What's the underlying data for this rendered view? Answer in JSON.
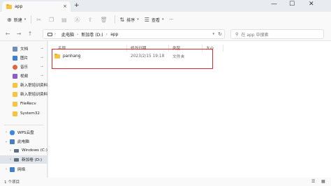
{
  "window": {
    "tab_title": "app",
    "tab_close": "×",
    "new_tab": "+",
    "minimize": "—",
    "maximize": "☐",
    "close": "✕"
  },
  "toolbar": {
    "new_label": "新建",
    "sort_label": "排序",
    "view_label": "查看",
    "more_label": "···"
  },
  "address": {
    "crumbs": [
      "此电脑",
      "新加卷 (D:)",
      "app"
    ],
    "search_placeholder": "在 app 中搜索"
  },
  "sidebar": {
    "quick": [
      {
        "label": "文档",
        "color": "#6b8fb5"
      },
      {
        "label": "图片",
        "color": "#3f7fcf"
      },
      {
        "label": "音乐",
        "color": "#e0623f"
      },
      {
        "label": "视频",
        "color": "#8b5cc9"
      },
      {
        "label": "新入职培训资料",
        "color": "#f6c441"
      },
      {
        "label": "新入职培训资料",
        "color": "#f6c441"
      },
      {
        "label": "FileRecv",
        "color": "#f6c441"
      },
      {
        "label": "System32",
        "color": "#f6c441"
      }
    ],
    "tree": [
      {
        "label": "WPS云盘",
        "color": "#3e86e5"
      },
      {
        "label": "此电脑",
        "color": "#4a7fbf"
      },
      {
        "label": "Windows (C:)",
        "color": "#5e6f80"
      },
      {
        "label": "新加卷 (D:)",
        "color": "#5e6f80"
      },
      {
        "label": "网络",
        "color": "#3f7fcf"
      }
    ]
  },
  "list": {
    "columns": [
      "名称",
      "修改日期",
      "类型",
      "大小"
    ],
    "rows": [
      {
        "name": "panhang",
        "date": "2023/2/15 19:18",
        "type": "文件夹"
      }
    ]
  },
  "status": {
    "count": "1 个项目"
  }
}
